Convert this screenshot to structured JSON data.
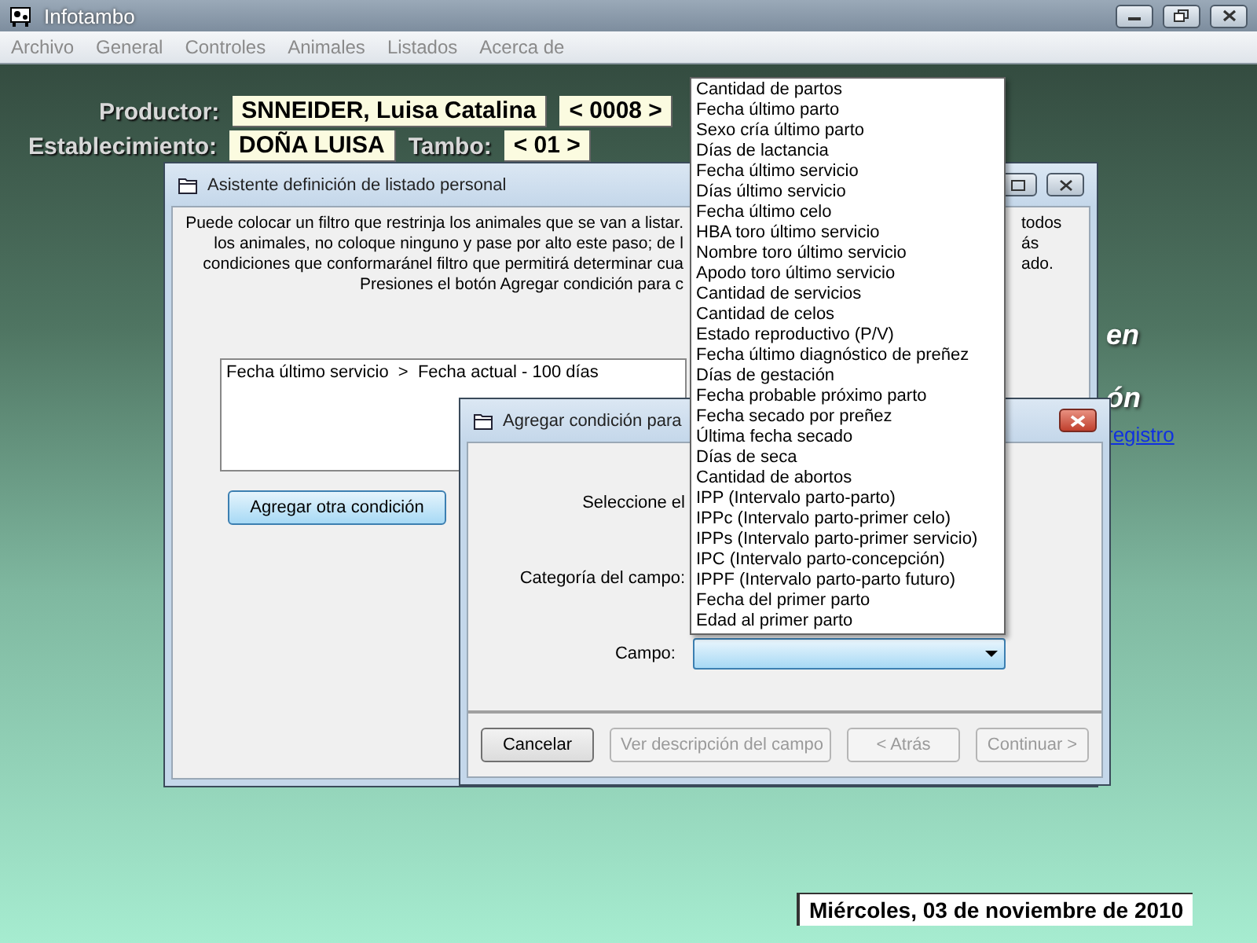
{
  "window": {
    "title": "Infotambo"
  },
  "menu": [
    "Archivo",
    "General",
    "Controles",
    "Animales",
    "Listados",
    "Acerca de"
  ],
  "header": [
    {
      "fields": [
        {
          "kind": "label",
          "text": "Productor:"
        },
        {
          "kind": "value",
          "text": "SNNEIDER, Luisa Catalina"
        },
        {
          "kind": "value",
          "text": "< 0008 >"
        }
      ]
    },
    {
      "fields": [
        {
          "kind": "label",
          "text": "Establecimiento:"
        },
        {
          "kind": "value",
          "text": "DOÑA LUISA"
        },
        {
          "kind": "label",
          "text": "Tambo:"
        },
        {
          "kind": "value",
          "text": "< 01 >"
        }
      ]
    }
  ],
  "background_texts": [
    {
      "kind": "heading",
      "text": "en"
    },
    {
      "kind": "heading",
      "text": "ón"
    },
    {
      "kind": "link",
      "text": "registro"
    }
  ],
  "wizard": {
    "title": "Asistente definición de listado personal",
    "intro_left": [
      "Puede colocar un filtro que restrinja los animales que se van a listar.",
      "los animales, no coloque ninguno y pase por alto este paso; de l",
      "condiciones que conformaránel filtro que permitirá determinar cua",
      "Presiones el botón Agregar condición para c"
    ],
    "intro_right": [
      "todos",
      "ás",
      "ado."
    ],
    "conditions": [
      {
        "text": "Fecha último servicio  >  Fecha actual - 100 días",
        "selected": false
      }
    ],
    "button": {
      "label": "Agregar otra condición",
      "focused": true
    }
  },
  "condition_dialog": {
    "title": "Agregar condición para",
    "rows": [
      {
        "kind": "text",
        "label": "Seleccione el"
      },
      {
        "kind": "text",
        "label": "Categoría del campo:"
      },
      {
        "kind": "combo",
        "label": "Campo:"
      }
    ],
    "options": [
      {
        "label": "Cantidad de partos",
        "selected": false
      },
      {
        "label": "Fecha último parto",
        "selected": false
      },
      {
        "label": "Sexo cría último parto",
        "selected": false
      },
      {
        "label": "Días de lactancia",
        "selected": false
      },
      {
        "label": "Fecha último servicio",
        "selected": false
      },
      {
        "label": "Días último servicio",
        "selected": false
      },
      {
        "label": "Fecha último celo",
        "selected": false
      },
      {
        "label": "HBA toro último servicio",
        "selected": false
      },
      {
        "label": "Nombre toro último servicio",
        "selected": false
      },
      {
        "label": "Apodo toro último servicio",
        "selected": false
      },
      {
        "label": "Cantidad de servicios",
        "selected": false
      },
      {
        "label": "Cantidad de celos",
        "selected": false
      },
      {
        "label": "Estado reproductivo (P/V)",
        "selected": false
      },
      {
        "label": "Fecha último diagnóstico de preñez",
        "selected": false
      },
      {
        "label": "Días de gestación",
        "selected": false
      },
      {
        "label": "Fecha probable próximo parto",
        "selected": false
      },
      {
        "label": "Fecha secado por preñez",
        "selected": false
      },
      {
        "label": "Última fecha secado",
        "selected": false
      },
      {
        "label": "Días de seca",
        "selected": false
      },
      {
        "label": "Cantidad de abortos",
        "selected": false
      },
      {
        "label": "IPP (Intervalo parto-parto)",
        "selected": false
      },
      {
        "label": "IPPc (Intervalo parto-primer celo)",
        "selected": false
      },
      {
        "label": "IPPs (Intervalo parto-primer servicio)",
        "selected": false
      },
      {
        "label": "IPC (Intervalo parto-concepción)",
        "selected": false
      },
      {
        "label": "IPPF (Intervalo parto-parto futuro)",
        "selected": false
      },
      {
        "label": "Fecha del primer parto",
        "selected": false
      },
      {
        "label": "Edad al primer parto",
        "selected": false
      }
    ],
    "buttons": [
      {
        "label": "Cancelar",
        "disabled": false
      },
      {
        "label": "Ver descripción del campo",
        "disabled": true
      },
      {
        "label": "< Atrás",
        "disabled": true
      },
      {
        "label": "Continuar >",
        "disabled": true
      }
    ]
  },
  "date": "Miércoles, 03 de noviembre de 2010"
}
